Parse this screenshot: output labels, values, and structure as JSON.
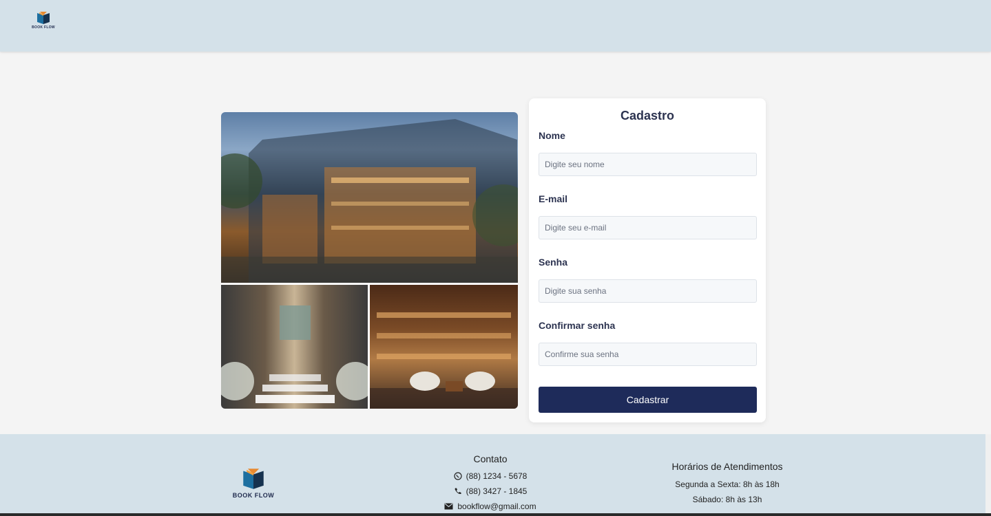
{
  "header": {
    "logo": {
      "icon": "book-logo-icon",
      "text": "BOOK FLOW"
    }
  },
  "gallery": {
    "photos": [
      "bookstore-exterior-photo",
      "entrance-stairs-photo",
      "reading-room-photo"
    ]
  },
  "form": {
    "title": "Cadastro",
    "fields": [
      {
        "label": "Nome",
        "placeholder": "Digite seu nome",
        "value": ""
      },
      {
        "label": "E-mail",
        "placeholder": "Digite seu e-mail",
        "value": ""
      },
      {
        "label": "Senha",
        "placeholder": "Digite sua senha",
        "value": ""
      },
      {
        "label": "Confirmar senha",
        "placeholder": "Confirme sua senha",
        "value": ""
      }
    ],
    "submit_label": "Cadastrar"
  },
  "footer": {
    "logo": {
      "icon": "book-logo-icon",
      "text": "BOOK FLOW"
    },
    "contact": {
      "title": "Contato",
      "whatsapp": {
        "icon": "whatsapp-icon",
        "text": "(88) 1234 - 5678"
      },
      "phone": {
        "icon": "phone-icon",
        "text": "(88) 3427 - 1845"
      },
      "email": {
        "icon": "envelope-icon",
        "text": "bookflow@gmail.com"
      }
    },
    "hours": {
      "title": "Horários de Atendimentos",
      "weekdays": "Segunda a Sexta: 8h às 18h",
      "saturday": "Sábado: 8h às 13h"
    }
  },
  "colors": {
    "header_bg": "#d4e1e9",
    "primary_button": "#1e2b5a",
    "page_bg": "#f4f4f4",
    "title_text": "#2c3350"
  }
}
